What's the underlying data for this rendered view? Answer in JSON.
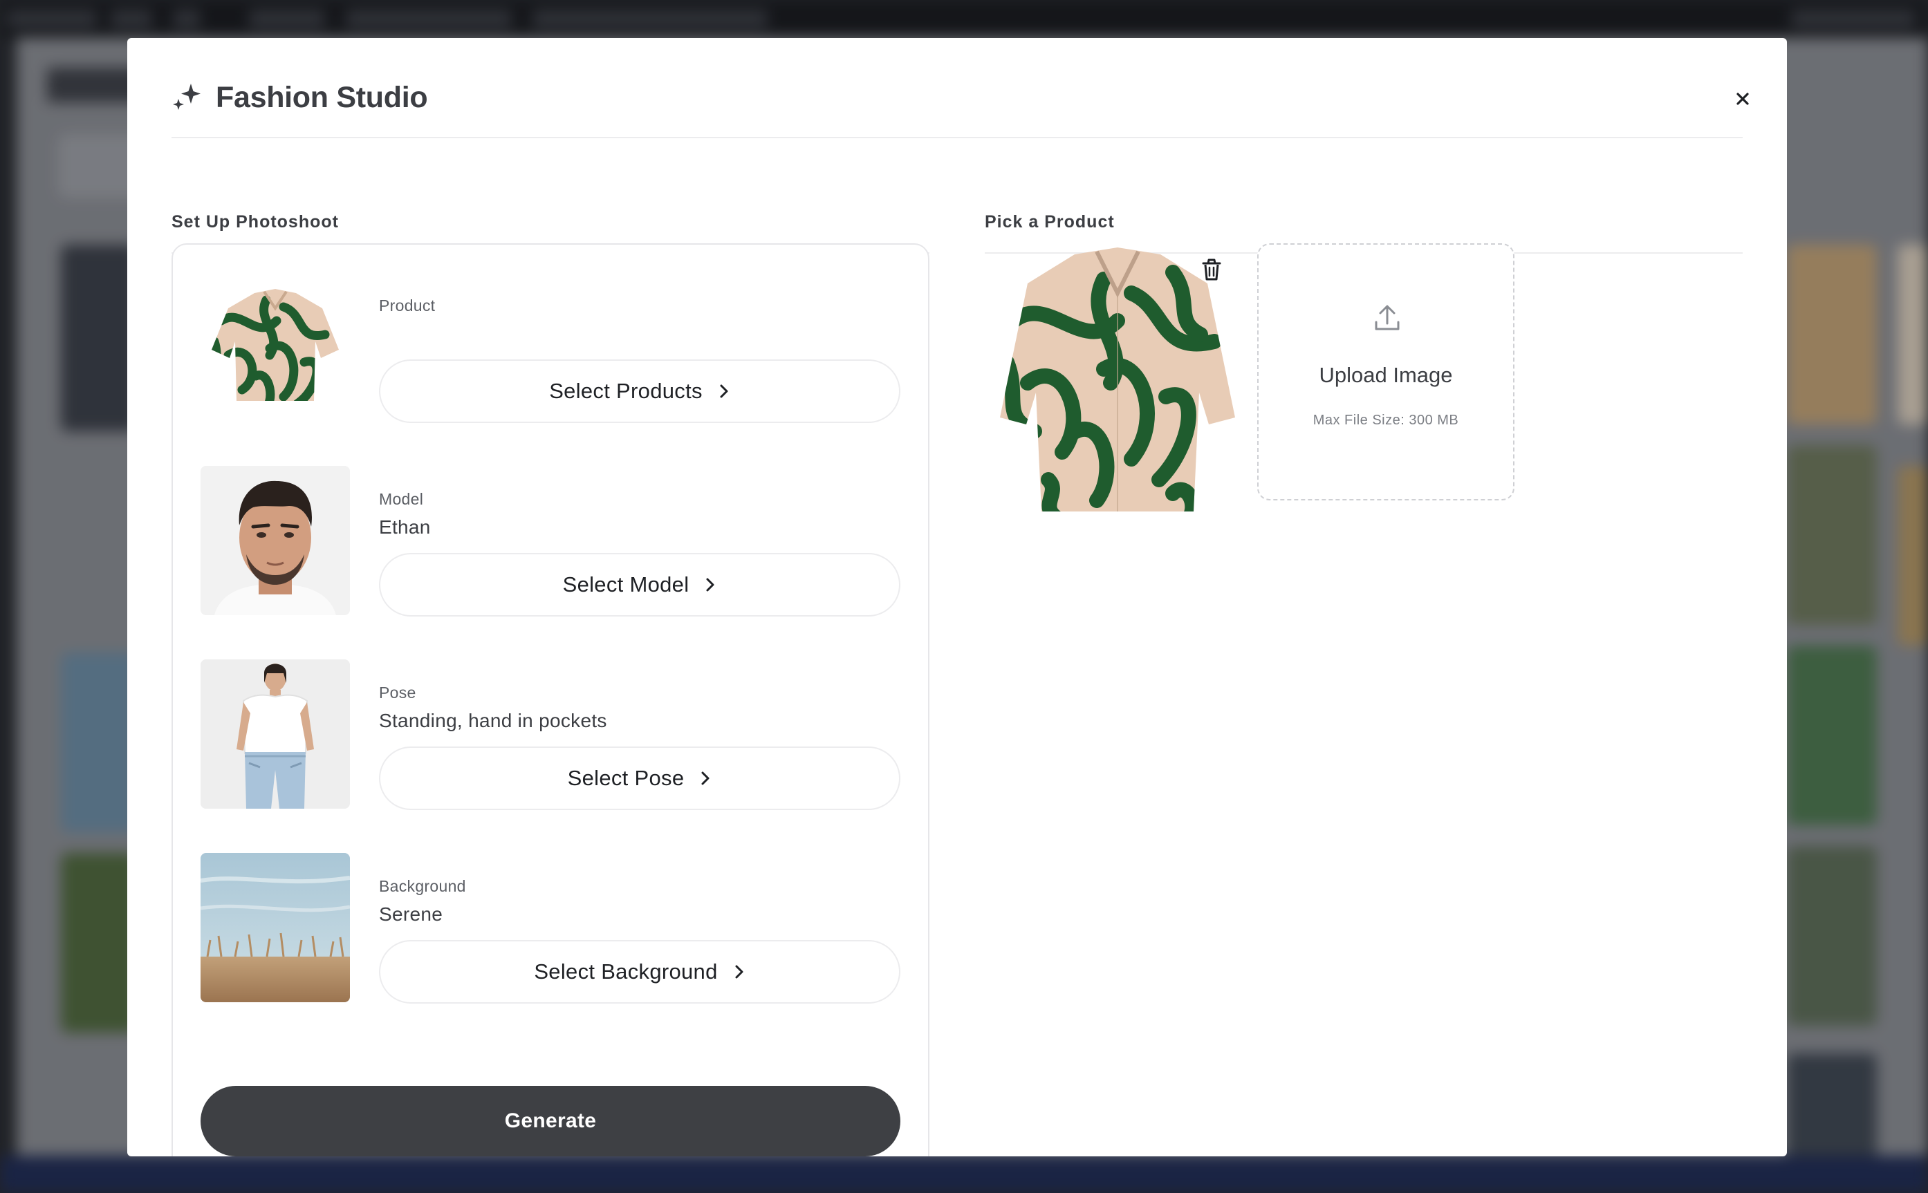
{
  "modal": {
    "title": "Fashion Studio",
    "close_label": "×"
  },
  "setup": {
    "section_title": "Set Up Photoshoot",
    "rows": [
      {
        "label": "Product",
        "value": "",
        "button": "Select Products",
        "thumb": "shirt-thumbnail"
      },
      {
        "label": "Model",
        "value": "Ethan",
        "button": "Select Model",
        "thumb": "model-portrait"
      },
      {
        "label": "Pose",
        "value": "Standing, hand in pockets",
        "button": "Select Pose",
        "thumb": "pose-photo"
      },
      {
        "label": "Background",
        "value": "Serene",
        "button": "Select Background",
        "thumb": "background-photo"
      }
    ],
    "generate_label": "Generate"
  },
  "picker": {
    "section_title": "Pick a Product",
    "upload_title": "Upload Image",
    "upload_caption": "Max File Size: 300 MB"
  },
  "icons": {
    "title": "sparkle-icon",
    "close": "close-icon",
    "chevron": "chevron-right-icon",
    "delete": "trash-icon",
    "upload": "upload-icon"
  },
  "colors": {
    "primary_button": "#3e4044",
    "border": "#ececee",
    "text": "#3c3e43",
    "shirt_green": "#1f5c2e",
    "shirt_base": "#e7c9b3"
  }
}
